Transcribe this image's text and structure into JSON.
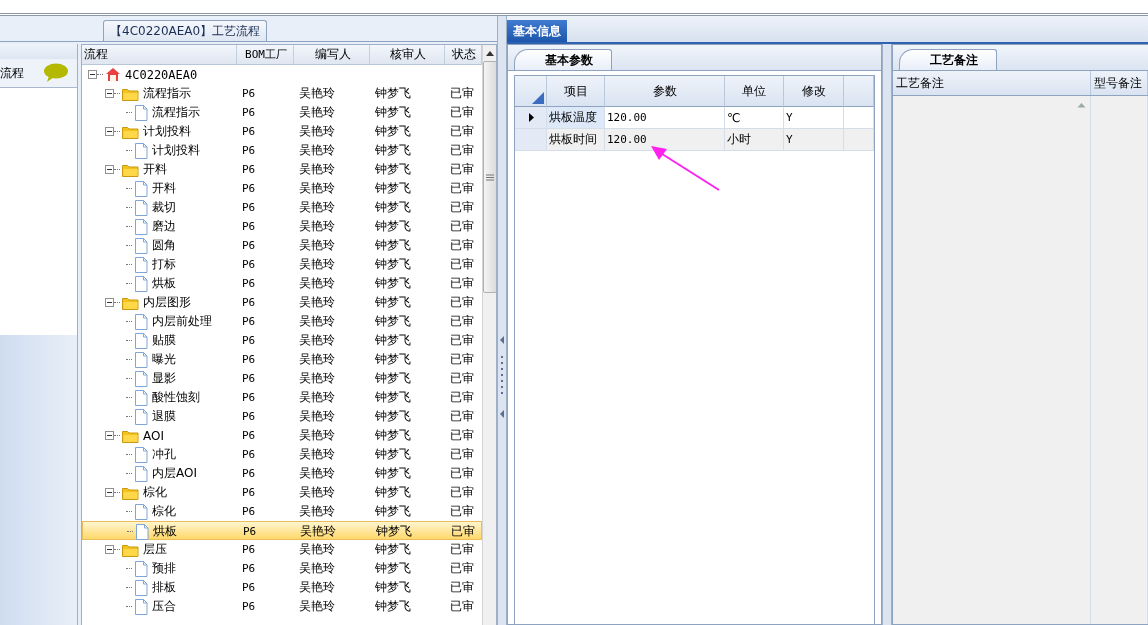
{
  "flow_tab": {
    "label": "【4C0220AEA0】工艺流程"
  },
  "left_panel": {
    "label": "流程"
  },
  "tree": {
    "columns": [
      "流程",
      "BOM工厂",
      "编写人",
      "核审人",
      "状态"
    ],
    "root": {
      "label": "4C0220AEA0",
      "expanded": true,
      "selected": false,
      "children": [
        {
          "label": "流程指示",
          "expanded": true,
          "selected": false,
          "bom": "P6",
          "author": "吴艳玲",
          "reviewer": "钟梦飞",
          "status": "已审",
          "children": [
            {
              "label": "流程指示",
              "selected": false,
              "bom": "P6",
              "author": "吴艳玲",
              "reviewer": "钟梦飞",
              "status": "已审"
            }
          ]
        },
        {
          "label": "计划投料",
          "expanded": true,
          "selected": false,
          "bom": "P6",
          "author": "吴艳玲",
          "reviewer": "钟梦飞",
          "status": "已审",
          "children": [
            {
              "label": "计划投料",
              "selected": false,
              "bom": "P6",
              "author": "吴艳玲",
              "reviewer": "钟梦飞",
              "status": "已审"
            }
          ]
        },
        {
          "label": "开料",
          "expanded": true,
          "selected": false,
          "bom": "P6",
          "author": "吴艳玲",
          "reviewer": "钟梦飞",
          "status": "已审",
          "children": [
            {
              "label": "开料",
              "selected": false,
              "bom": "P6",
              "author": "吴艳玲",
              "reviewer": "钟梦飞",
              "status": "已审"
            },
            {
              "label": "裁切",
              "selected": false,
              "bom": "P6",
              "author": "吴艳玲",
              "reviewer": "钟梦飞",
              "status": "已审"
            },
            {
              "label": "磨边",
              "selected": false,
              "bom": "P6",
              "author": "吴艳玲",
              "reviewer": "钟梦飞",
              "status": "已审"
            },
            {
              "label": "圆角",
              "selected": false,
              "bom": "P6",
              "author": "吴艳玲",
              "reviewer": "钟梦飞",
              "status": "已审"
            },
            {
              "label": "打标",
              "selected": false,
              "bom": "P6",
              "author": "吴艳玲",
              "reviewer": "钟梦飞",
              "status": "已审"
            },
            {
              "label": "烘板",
              "selected": false,
              "bom": "P6",
              "author": "吴艳玲",
              "reviewer": "钟梦飞",
              "status": "已审"
            }
          ]
        },
        {
          "label": "内层图形",
          "expanded": true,
          "selected": false,
          "bom": "P6",
          "author": "吴艳玲",
          "reviewer": "钟梦飞",
          "status": "已审",
          "children": [
            {
              "label": "内层前处理",
              "selected": false,
              "bom": "P6",
              "author": "吴艳玲",
              "reviewer": "钟梦飞",
              "status": "已审"
            },
            {
              "label": "贴膜",
              "selected": false,
              "bom": "P6",
              "author": "吴艳玲",
              "reviewer": "钟梦飞",
              "status": "已审"
            },
            {
              "label": "曝光",
              "selected": false,
              "bom": "P6",
              "author": "吴艳玲",
              "reviewer": "钟梦飞",
              "status": "已审"
            },
            {
              "label": "显影",
              "selected": false,
              "bom": "P6",
              "author": "吴艳玲",
              "reviewer": "钟梦飞",
              "status": "已审"
            },
            {
              "label": "酸性蚀刻",
              "selected": false,
              "bom": "P6",
              "author": "吴艳玲",
              "reviewer": "钟梦飞",
              "status": "已审"
            },
            {
              "label": "退膜",
              "selected": false,
              "bom": "P6",
              "author": "吴艳玲",
              "reviewer": "钟梦飞",
              "status": "已审"
            }
          ]
        },
        {
          "label": "AOI",
          "expanded": true,
          "selected": false,
          "bom": "P6",
          "author": "吴艳玲",
          "reviewer": "钟梦飞",
          "status": "已审",
          "children": [
            {
              "label": "冲孔",
              "selected": false,
              "bom": "P6",
              "author": "吴艳玲",
              "reviewer": "钟梦飞",
              "status": "已审"
            },
            {
              "label": "内层AOI",
              "selected": false,
              "bom": "P6",
              "author": "吴艳玲",
              "reviewer": "钟梦飞",
              "status": "已审"
            }
          ]
        },
        {
          "label": "棕化",
          "expanded": true,
          "selected": false,
          "bom": "P6",
          "author": "吴艳玲",
          "reviewer": "钟梦飞",
          "status": "已审",
          "children": [
            {
              "label": "棕化",
              "selected": false,
              "bom": "P6",
              "author": "吴艳玲",
              "reviewer": "钟梦飞",
              "status": "已审"
            },
            {
              "label": "烘板",
              "selected": true,
              "bom": "P6",
              "author": "吴艳玲",
              "reviewer": "钟梦飞",
              "status": "已审"
            }
          ]
        },
        {
          "label": "层压",
          "expanded": true,
          "selected": false,
          "bom": "P6",
          "author": "吴艳玲",
          "reviewer": "钟梦飞",
          "status": "已审",
          "children": [
            {
              "label": "预排",
              "selected": false,
              "bom": "P6",
              "author": "吴艳玲",
              "reviewer": "钟梦飞",
              "status": "已审"
            },
            {
              "label": "排板",
              "selected": false,
              "bom": "P6",
              "author": "吴艳玲",
              "reviewer": "钟梦飞",
              "status": "已审"
            },
            {
              "label": "压合",
              "selected": false,
              "bom": "P6",
              "author": "吴艳玲",
              "reviewer": "钟梦飞",
              "status": "已审"
            }
          ]
        }
      ]
    }
  },
  "main_tabs": [
    {
      "label": "基本信息",
      "selected": true
    }
  ],
  "params": {
    "tabs": [
      {
        "label": "基本参数",
        "selected": true
      }
    ],
    "columns": [
      "项目",
      "参数",
      "单位",
      "修改"
    ],
    "rows": [
      {
        "current": true,
        "item": "烘板温度",
        "value": "120.00",
        "unit": "℃",
        "modified": "Y"
      },
      {
        "current": false,
        "item": "烘板时间",
        "value": "120.00",
        "unit": "小时",
        "modified": "Y"
      }
    ]
  },
  "notes": {
    "tabs": [
      {
        "label": "工艺备注",
        "selected": true
      }
    ],
    "columns": [
      "工艺备注",
      "型号备注"
    ]
  }
}
